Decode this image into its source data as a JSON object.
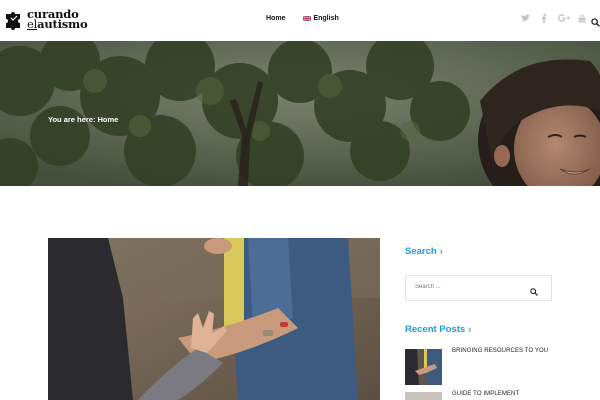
{
  "header": {
    "logo": {
      "line1": "curando",
      "line2_prefix": "el",
      "line2_suffix": "autismo"
    },
    "nav": {
      "home": "Home",
      "language": "English"
    },
    "social_icons": [
      "twitter-icon",
      "facebook-icon",
      "google-plus-icon",
      "youtube-icon"
    ],
    "search_icon": "search-icon"
  },
  "hero": {
    "breadcrumb": "You are here: Home"
  },
  "sidebar": {
    "search": {
      "title": "Search",
      "chevron": "›",
      "placeholder": "Search ..."
    },
    "recent_posts": {
      "title": "Recent Posts",
      "chevron": "›",
      "items": [
        {
          "title": "BRINGING RESOURCES TO YOU"
        },
        {
          "title": "GUIDE TO IMPLEMENT"
        }
      ]
    }
  },
  "colors": {
    "accent": "#1e9bd7",
    "social_gray": "#bdbdbd",
    "text_dark": "#111111"
  }
}
